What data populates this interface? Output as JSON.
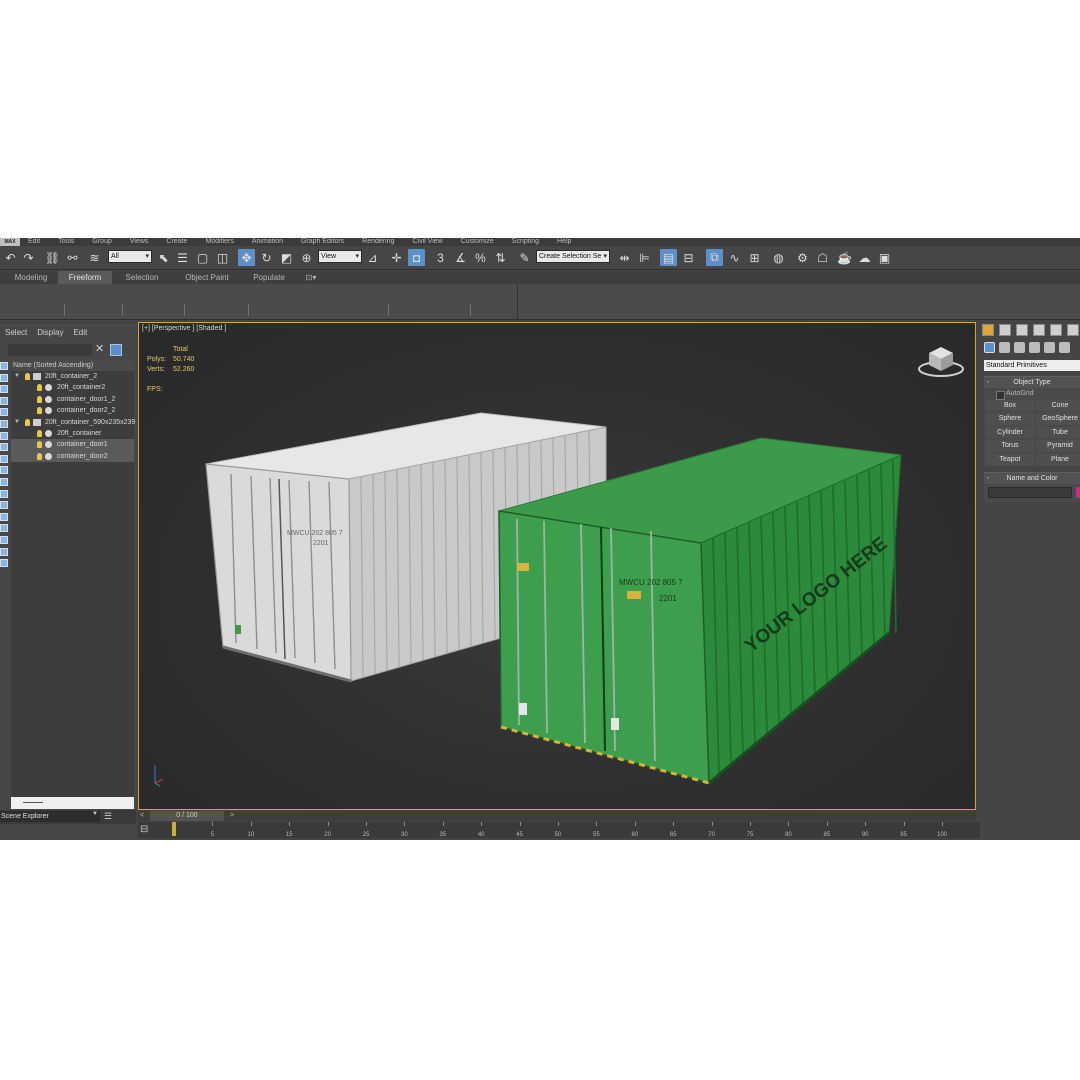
{
  "menu": [
    "Edit",
    "Tools",
    "Group",
    "Views",
    "Create",
    "Modifiers",
    "Animation",
    "Graph Editors",
    "Rendering",
    "Civil View",
    "Customize",
    "Scripting",
    "Help"
  ],
  "logo": "MAX",
  "toolbar": {
    "filter_value": "All",
    "refcoord_value": "View",
    "selection_set_placeholder": "Create Selection Se"
  },
  "ribbon_tabs": [
    "Modeling",
    "Freeform",
    "Selection",
    "Object Paint",
    "Populate"
  ],
  "ribbon_active": "Freeform",
  "scene_explorer": {
    "tabs": [
      "Select",
      "Display",
      "Edit"
    ],
    "header": "Name (Sorted Ascending)",
    "rows": [
      {
        "label": "20ft_container_2",
        "level": 0,
        "kind": "group"
      },
      {
        "label": "20ft_container2",
        "level": 1,
        "kind": "object"
      },
      {
        "label": "container_door1_2",
        "level": 1,
        "kind": "object"
      },
      {
        "label": "container_door2_2",
        "level": 1,
        "kind": "object"
      },
      {
        "label": "20ft_container_590x235x239",
        "level": 0,
        "kind": "group"
      },
      {
        "label": "20ft_container",
        "level": 1,
        "kind": "object"
      },
      {
        "label": "container_door1",
        "level": 1,
        "kind": "object"
      },
      {
        "label": "container_door2",
        "level": 1,
        "kind": "object"
      }
    ],
    "footer_label": "Scene Explorer"
  },
  "viewport": {
    "label": "[+] [Perspective ] [Shaded ]",
    "stats_total": "Total",
    "polys_label": "Polys:",
    "polys_value": "50.740",
    "verts_label": "Verts:",
    "verts_value": "52.260",
    "fps_label": "FPS:",
    "containers": {
      "white_color": "#d8d8d8",
      "green_color": "#2d8a3e",
      "door_text_1": "MWCU 202 805 7",
      "door_text_2": "2201",
      "side_text": "YOUR LOGO HERE"
    }
  },
  "timeline": {
    "frame_display": "0 / 100",
    "ticks": [
      "5",
      "10",
      "15",
      "20",
      "25",
      "30",
      "35",
      "40",
      "45",
      "50",
      "55",
      "60",
      "65",
      "70",
      "75",
      "80",
      "85",
      "90",
      "95",
      "100"
    ]
  },
  "command_panel": {
    "category": "Standard Primitives",
    "object_type_title": "Object Type",
    "autogrid": "AutoGrid",
    "primitives": [
      "Box",
      "Cone",
      "Sphere",
      "GeoSphere",
      "Cylinder",
      "Tube",
      "Torus",
      "Pyramid",
      "Teapot",
      "Plane"
    ],
    "name_color_title": "Name and Color",
    "object_color": "#d4258c"
  }
}
